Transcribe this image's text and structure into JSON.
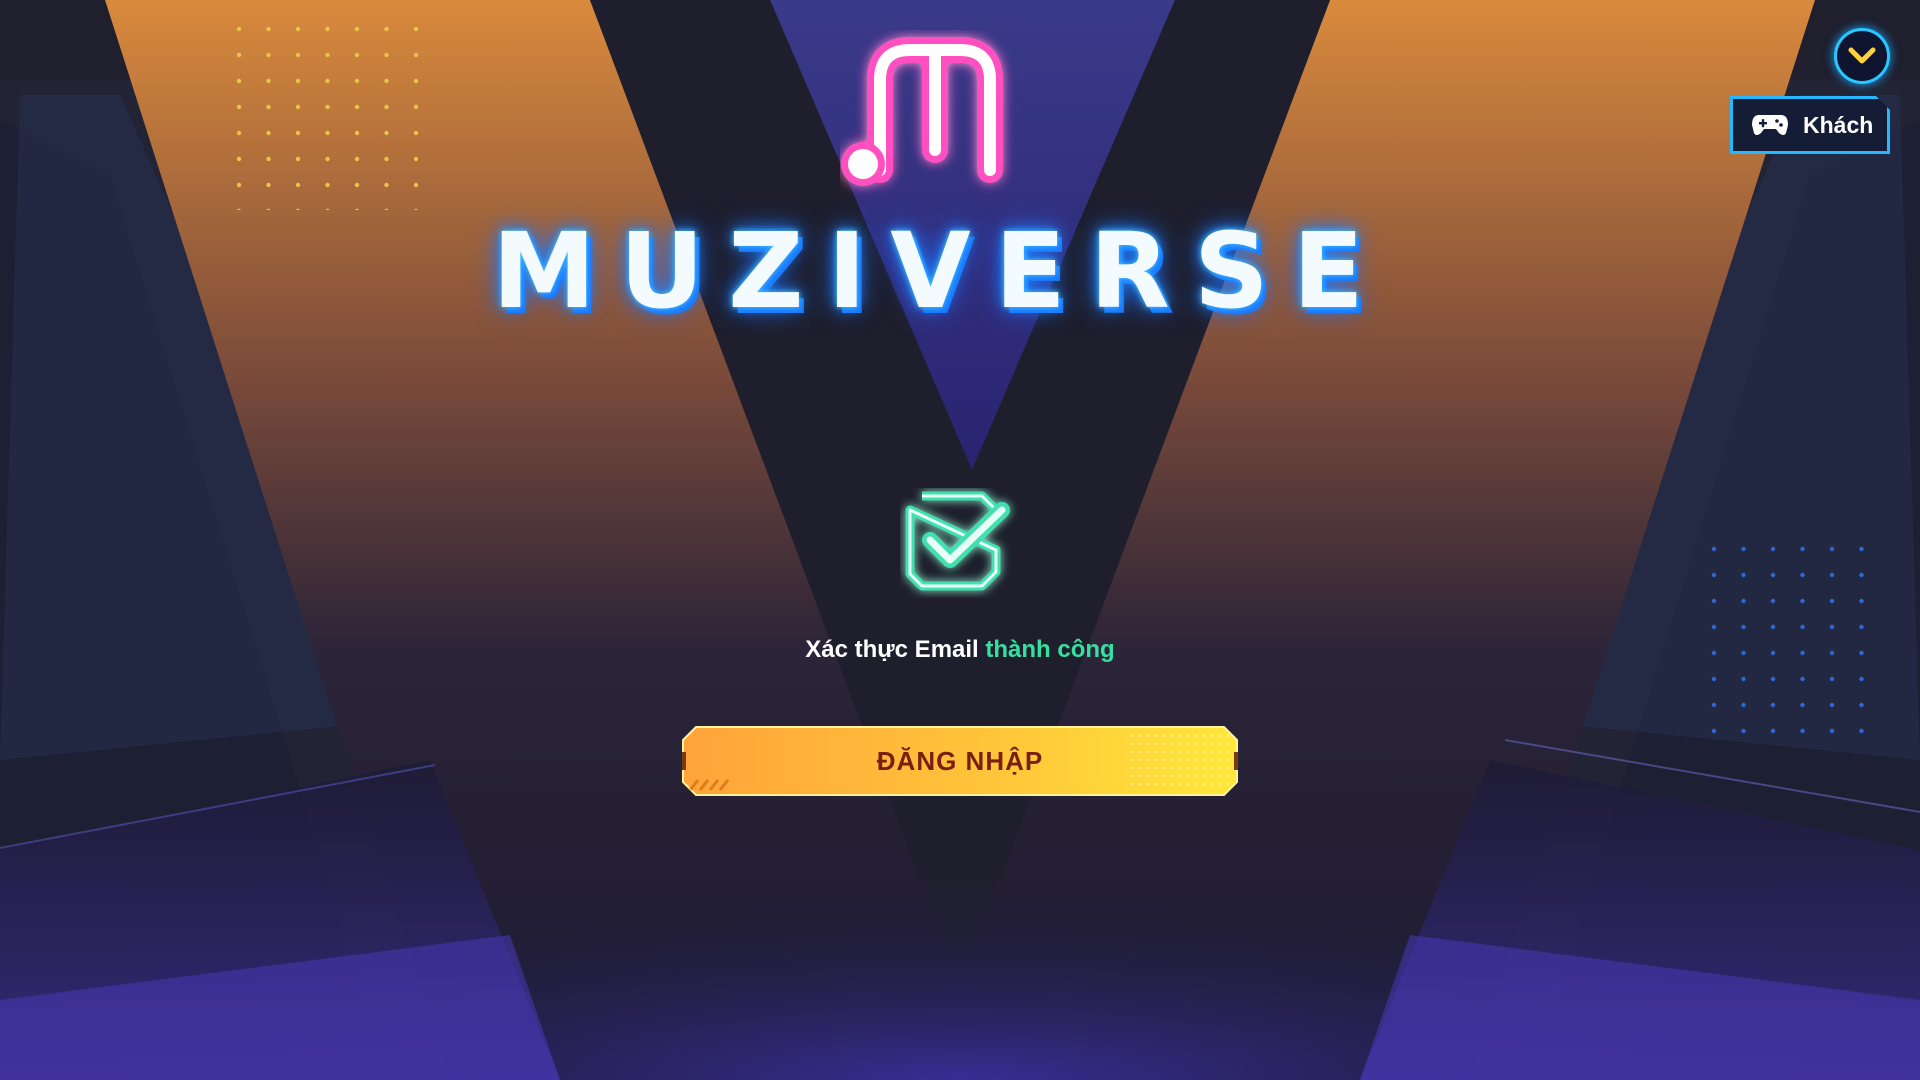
{
  "app": {
    "logo_text": "MUZIVERSE"
  },
  "header": {
    "guest_label": "Khách",
    "guest_icon": "gamepad-icon",
    "dropdown_icon": "chevron-down-icon"
  },
  "verification": {
    "status_icon": "check-square-icon",
    "message_prefix": "Xác thực Email",
    "message_status": "thành công"
  },
  "actions": {
    "login_label": "ĐĂNG NHẬP"
  },
  "colors": {
    "accent_cyan": "#26b8ff",
    "success_green": "#35e0a0",
    "button_orange": "#ffa43a",
    "button_yellow": "#ffe83a",
    "logo_pink": "#ff4fc0"
  }
}
